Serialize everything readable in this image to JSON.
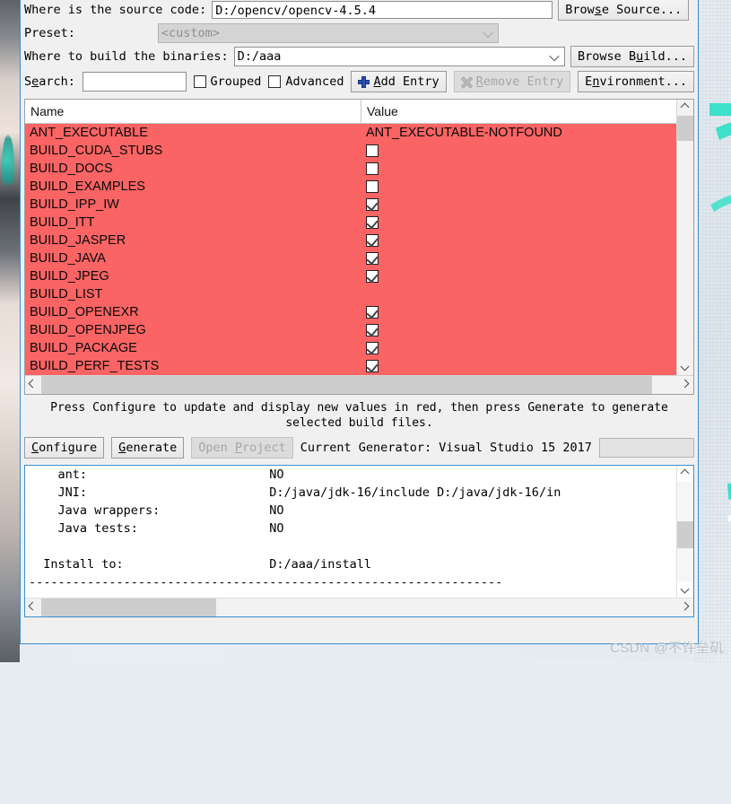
{
  "window": {
    "accent_color": "#3a8fd0",
    "red_row_color": "#fb6464"
  },
  "source_row": {
    "label": "Where is the source code:",
    "value": "D:/opencv/opencv-4.5.4",
    "browse_button": "Browse Source..."
  },
  "preset_row": {
    "label": "Preset:",
    "value": "<custom>"
  },
  "build_row": {
    "label": "Where to build the binaries:",
    "value": "D:/aaa",
    "browse_button": "Browse Build..."
  },
  "search_row": {
    "label": "Search:",
    "label_mnemonic": "e",
    "value": "",
    "placeholder": "",
    "grouped_label": "Grouped",
    "grouped_checked": false,
    "advanced_label": "Advanced",
    "advanced_checked": false,
    "add_entry_label": "Add Entry",
    "add_entry_mnemonic": "A",
    "remove_entry_label": "Remove Entry",
    "remove_entry_mnemonic": "R",
    "remove_entry_disabled": true,
    "environment_label": "Environment...",
    "environment_mnemonic": "n"
  },
  "cache_table": {
    "columns": [
      "Name",
      "Value"
    ],
    "rows": [
      {
        "name": "ANT_EXECUTABLE",
        "value_type": "text",
        "value": "ANT_EXECUTABLE-NOTFOUND"
      },
      {
        "name": "BUILD_CUDA_STUBS",
        "value_type": "checkbox",
        "checked": false
      },
      {
        "name": "BUILD_DOCS",
        "value_type": "checkbox",
        "checked": false
      },
      {
        "name": "BUILD_EXAMPLES",
        "value_type": "checkbox",
        "checked": false
      },
      {
        "name": "BUILD_IPP_IW",
        "value_type": "checkbox",
        "checked": true
      },
      {
        "name": "BUILD_ITT",
        "value_type": "checkbox",
        "checked": true
      },
      {
        "name": "BUILD_JASPER",
        "value_type": "checkbox",
        "checked": true
      },
      {
        "name": "BUILD_JAVA",
        "value_type": "checkbox",
        "checked": true
      },
      {
        "name": "BUILD_JPEG",
        "value_type": "checkbox",
        "checked": true
      },
      {
        "name": "BUILD_LIST",
        "value_type": "empty"
      },
      {
        "name": "BUILD_OPENEXR",
        "value_type": "checkbox",
        "checked": true
      },
      {
        "name": "BUILD_OPENJPEG",
        "value_type": "checkbox",
        "checked": true
      },
      {
        "name": "BUILD_PACKAGE",
        "value_type": "checkbox",
        "checked": true
      },
      {
        "name": "BUILD_PERF_TESTS",
        "value_type": "checkbox",
        "checked": true
      }
    ]
  },
  "hint": {
    "line1": "Press Configure to update and display new values in red, then press Generate to generate",
    "line2": "selected build files."
  },
  "actions": {
    "configure_label": "Configure",
    "configure_mnemonic": "C",
    "generate_label": "Generate",
    "generate_mnemonic": "G",
    "open_project_label": "Open Project",
    "open_project_mnemonic": "P",
    "open_project_disabled": true,
    "current_generator_label": "Current Generator: Visual Studio 15 2017",
    "generator_blank_value": ""
  },
  "log": {
    "text": "    ant:                         NO\n    JNI:                         D:/java/jdk-16/include D:/java/jdk-16/in\n    Java wrappers:               NO\n    Java tests:                  NO\n\n  Install to:                    D:/aaa/install\n-----------------------------------------------------------------\n\nConfiguring done"
  },
  "watermark": {
    "text": "CSDN @不许垒矶"
  }
}
